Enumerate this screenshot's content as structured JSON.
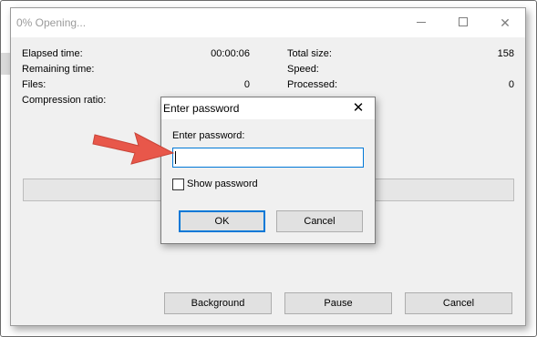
{
  "window": {
    "title": "0% Opening...",
    "stats_left": [
      {
        "label": "Elapsed time:",
        "value": "00:00:06"
      },
      {
        "label": "Remaining time:",
        "value": ""
      },
      {
        "label": "Files:",
        "value": "0"
      },
      {
        "label": "Compression ratio:",
        "value": ""
      }
    ],
    "stats_right": [
      {
        "label": "Total size:",
        "value": "158"
      },
      {
        "label": "Speed:",
        "value": ""
      },
      {
        "label": "Processed:",
        "value": "0"
      }
    ],
    "progress_percent": 0,
    "buttons": {
      "background": "Background",
      "pause": "Pause",
      "cancel": "Cancel"
    }
  },
  "dialog": {
    "title": "Enter password",
    "close_glyph": "✕",
    "field_label": "Enter password:",
    "field_value": "",
    "show_password_label": "Show password",
    "show_password_checked": false,
    "ok_label": "OK",
    "cancel_label": "Cancel"
  },
  "annotation": {
    "arrow_color": "#e8574a"
  },
  "colors": {
    "focus_accent": "#0078d7",
    "window_bg": "#f0f0f0"
  }
}
